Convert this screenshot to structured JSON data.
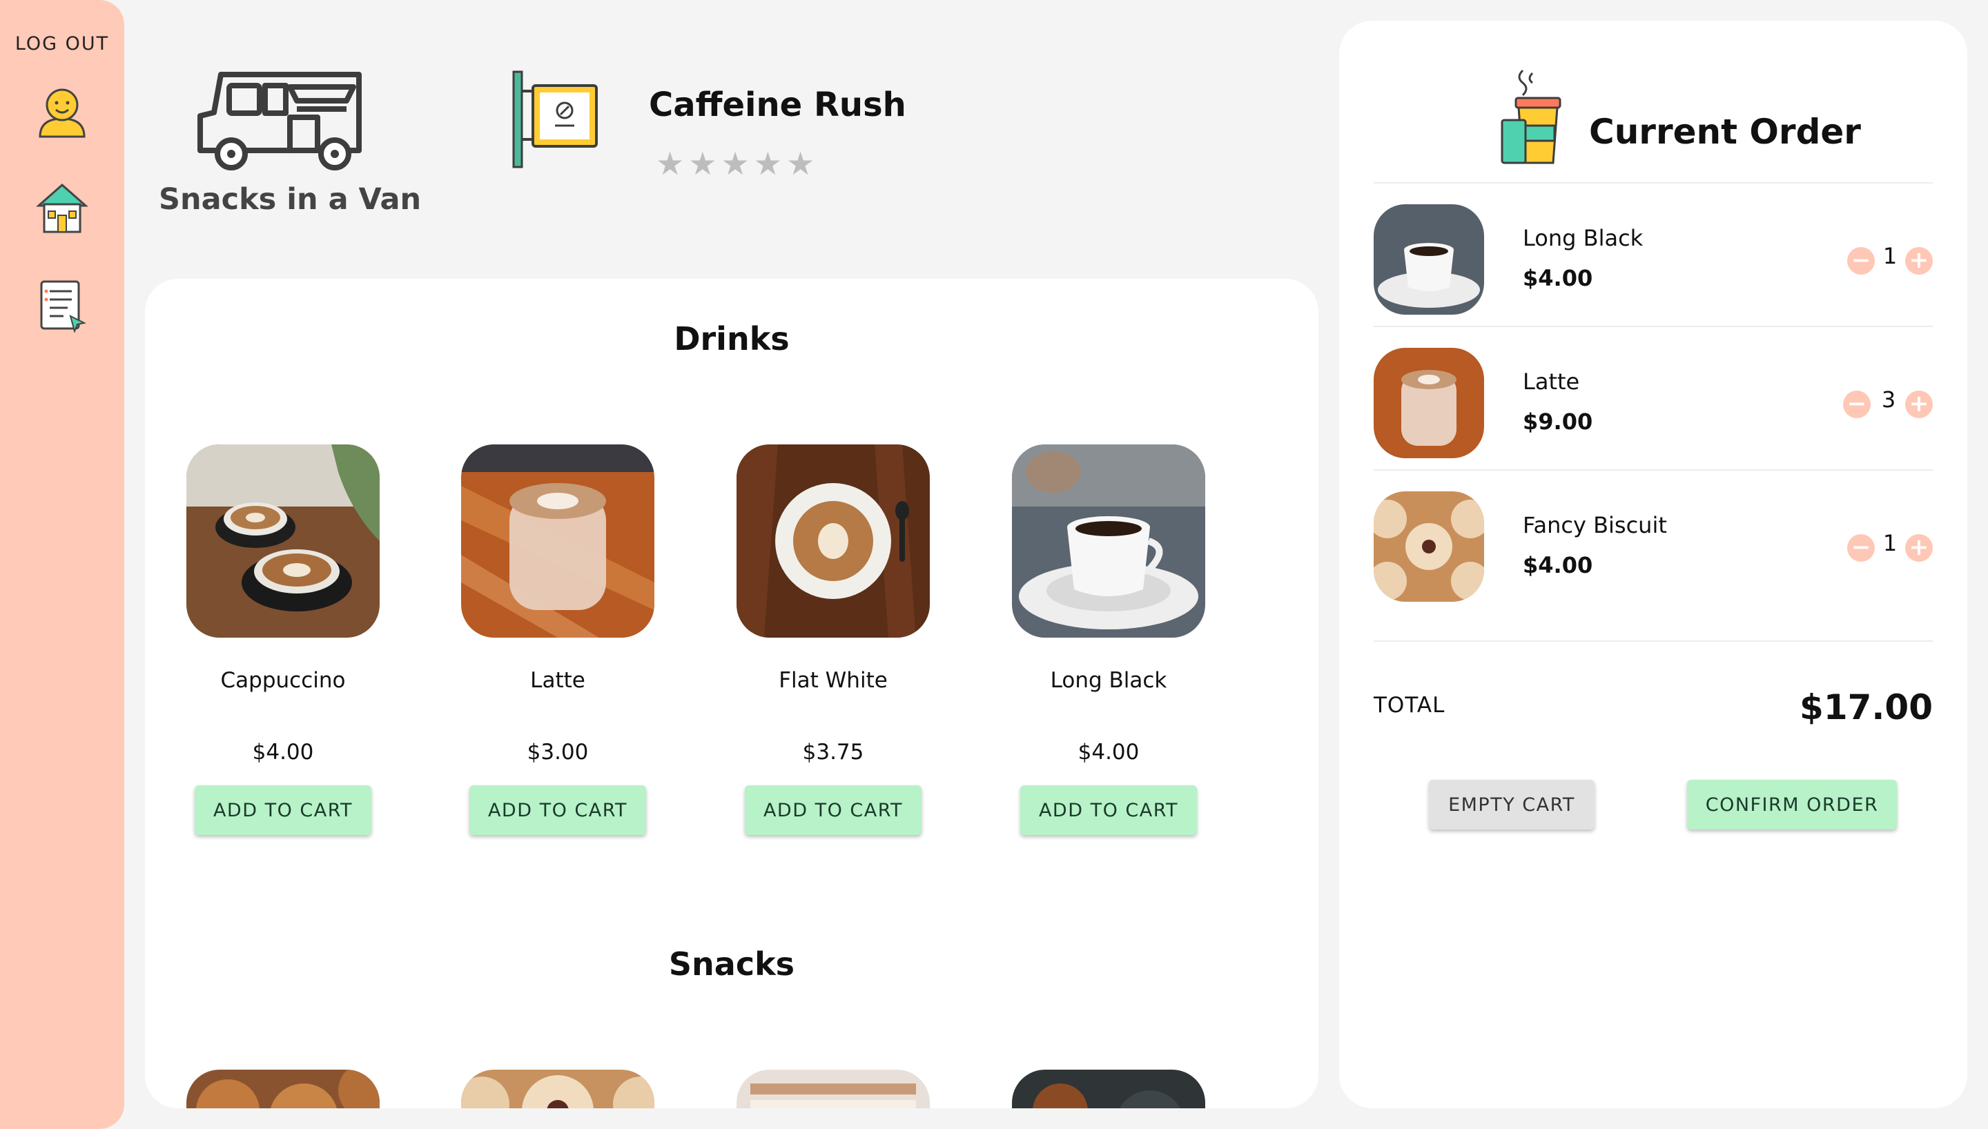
{
  "sidebar": {
    "logout_label": "LOG OUT",
    "icons": [
      "profile-icon",
      "home-icon",
      "orders-icon"
    ]
  },
  "header": {
    "brand": "Snacks in a Van",
    "van_name": "Caffeine Rush",
    "rating": {
      "stars": 5,
      "filled": 0
    }
  },
  "menu": {
    "drinks_title": "Drinks",
    "snacks_title": "Snacks",
    "add_label": "ADD TO CART",
    "drinks": [
      {
        "name": "Cappuccino",
        "price": "$4.00"
      },
      {
        "name": "Latte",
        "price": "$3.00"
      },
      {
        "name": "Flat White",
        "price": "$3.75"
      },
      {
        "name": "Long Black",
        "price": "$4.00"
      }
    ],
    "snacks_visible": 4
  },
  "order": {
    "title": "Current Order",
    "items": [
      {
        "name": "Long Black",
        "price": "$4.00",
        "qty": "1"
      },
      {
        "name": "Latte",
        "price": "$9.00",
        "qty": "3"
      },
      {
        "name": "Fancy Biscuit",
        "price": "$4.00",
        "qty": "1"
      }
    ],
    "total_label": "TOTAL",
    "total_value": "$17.00",
    "empty_label": "EMPTY CART",
    "confirm_label": "CONFIRM ORDER"
  },
  "colors": {
    "sidebar_bg": "#ffcab7",
    "add_button": "#b7f2c8",
    "qty_button": "#ffc7b5",
    "empty_button": "#e2e2e2"
  }
}
